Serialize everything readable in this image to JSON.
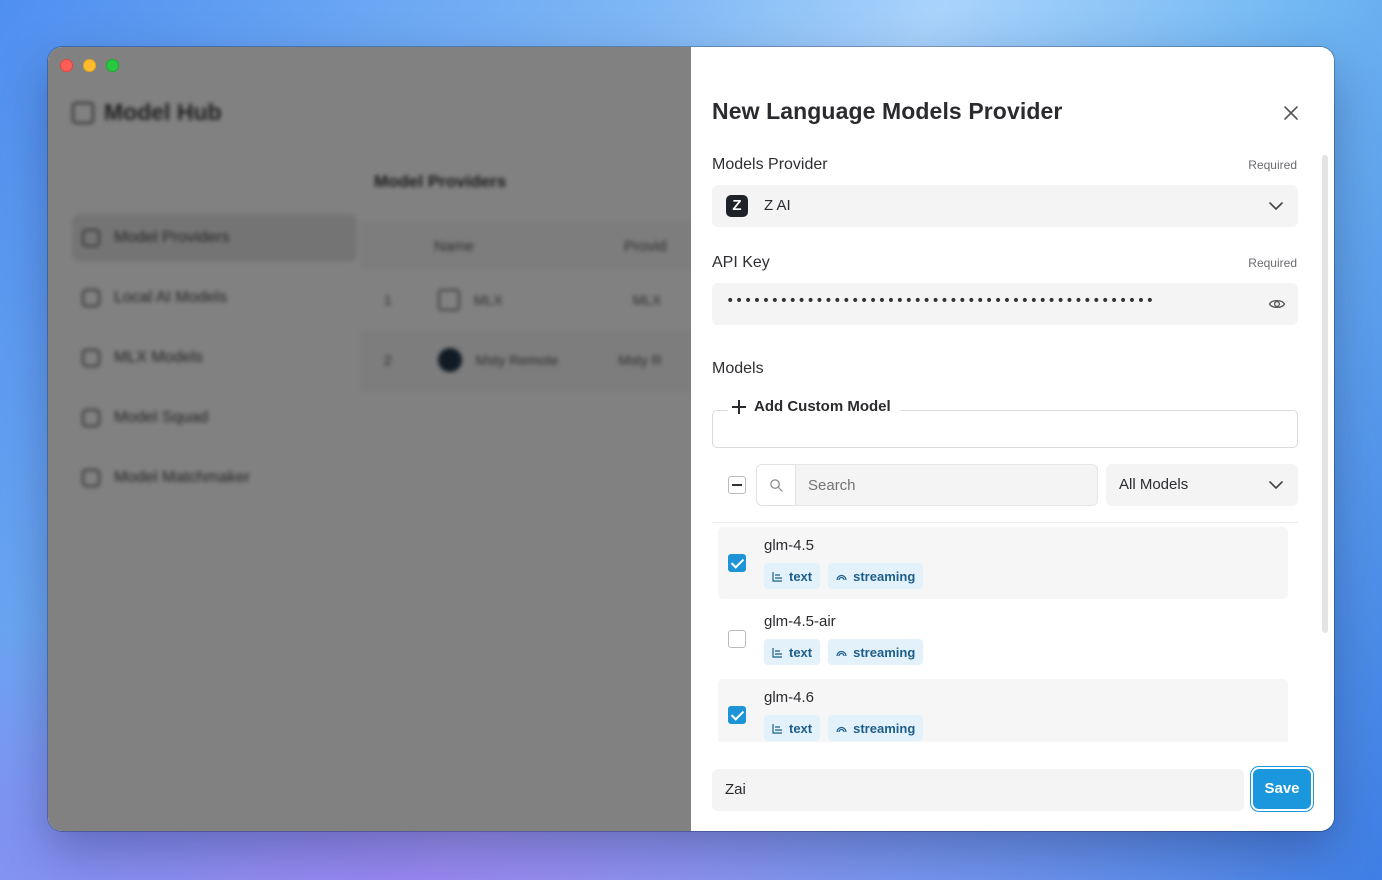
{
  "app": {
    "title": "Model Hub",
    "sidebar": [
      {
        "label": "Model Providers",
        "active": true
      },
      {
        "label": "Local AI Models",
        "active": false
      },
      {
        "label": "MLX Models",
        "active": false
      },
      {
        "label": "Model Squad",
        "active": false
      },
      {
        "label": "Model Matchmaker",
        "active": false
      }
    ],
    "section_title": "Model Providers",
    "table": {
      "headers": [
        "Name",
        "Provid"
      ],
      "rows": [
        {
          "index": "1",
          "name": "MLX",
          "provider": "MLX"
        },
        {
          "index": "2",
          "name": "Msty Remote",
          "provider": "Msty R"
        }
      ]
    }
  },
  "drawer": {
    "title": "New Language Models Provider",
    "provider_label": "Models Provider",
    "provider_required": "Required",
    "provider_logo": "Z",
    "provider_value": "Z AI",
    "api_key_label": "API Key",
    "api_key_required": "Required",
    "api_key_masked": "••••••••••••••••••••••••••••••••••••••••••••••••",
    "models_label": "Models",
    "add_custom_label": "Add Custom Model",
    "search_placeholder": "Search",
    "filter_value": "All Models",
    "models": [
      {
        "name": "glm-4.5",
        "checked": true,
        "tags": [
          "text",
          "streaming"
        ]
      },
      {
        "name": "glm-4.5-air",
        "checked": false,
        "tags": [
          "text",
          "streaming"
        ]
      },
      {
        "name": "glm-4.6",
        "checked": true,
        "tags": [
          "text",
          "streaming"
        ]
      }
    ],
    "name_value": "Zai",
    "save_label": "Save"
  },
  "colors": {
    "accent": "#1a97dd",
    "tag_bg": "#e3f1fb",
    "tag_text": "#1d5f8a"
  }
}
